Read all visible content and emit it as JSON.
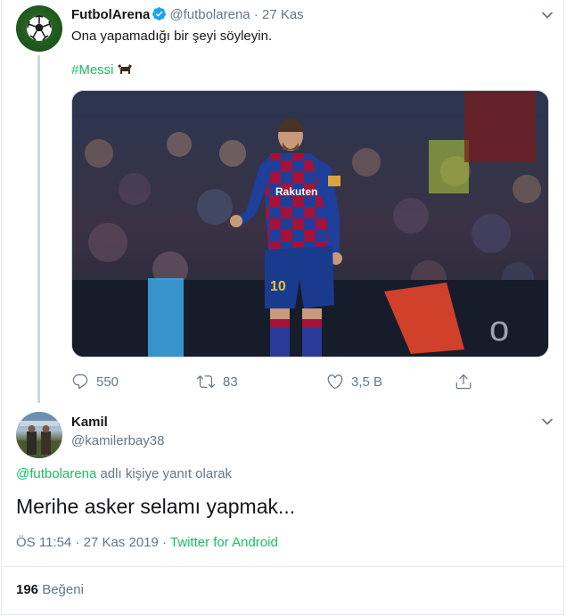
{
  "tweet": {
    "display_name": "FutbolArena",
    "handle": "@futbolarena",
    "separator": "·",
    "date": "27 Kas",
    "text": "Ona yapamadığı bir şeyi söyleyin.",
    "hashtag": "#Messi",
    "media": {
      "sponsor_text": "Rakuten",
      "shirt_number": "10"
    },
    "stats": {
      "replies": "550",
      "retweets": "83",
      "likes": "3,5 B"
    }
  },
  "reply": {
    "display_name": "Kamil",
    "handle": "@kamilerbay38",
    "replying_to_mention": "@futbolarena",
    "replying_to_suffix": " adlı kişiye yanıt olarak",
    "text": "Merihe asker selamı yapmak...",
    "time": "ÖS 11:54",
    "separator": " · ",
    "date": "27 Kas 2019",
    "separator2": " · ",
    "source": "Twitter for Android",
    "like_count": "196",
    "like_label": "Beğeni"
  },
  "colors": {
    "accent": "#17bf63",
    "muted": "#657786",
    "text": "#14171a",
    "verified": "#1da1f2",
    "border": "#e6ecf0"
  },
  "icons": [
    "verified-badge-icon",
    "chevron-down-icon",
    "ox-emoji-icon",
    "reply-icon",
    "retweet-icon",
    "like-icon",
    "share-icon"
  ]
}
